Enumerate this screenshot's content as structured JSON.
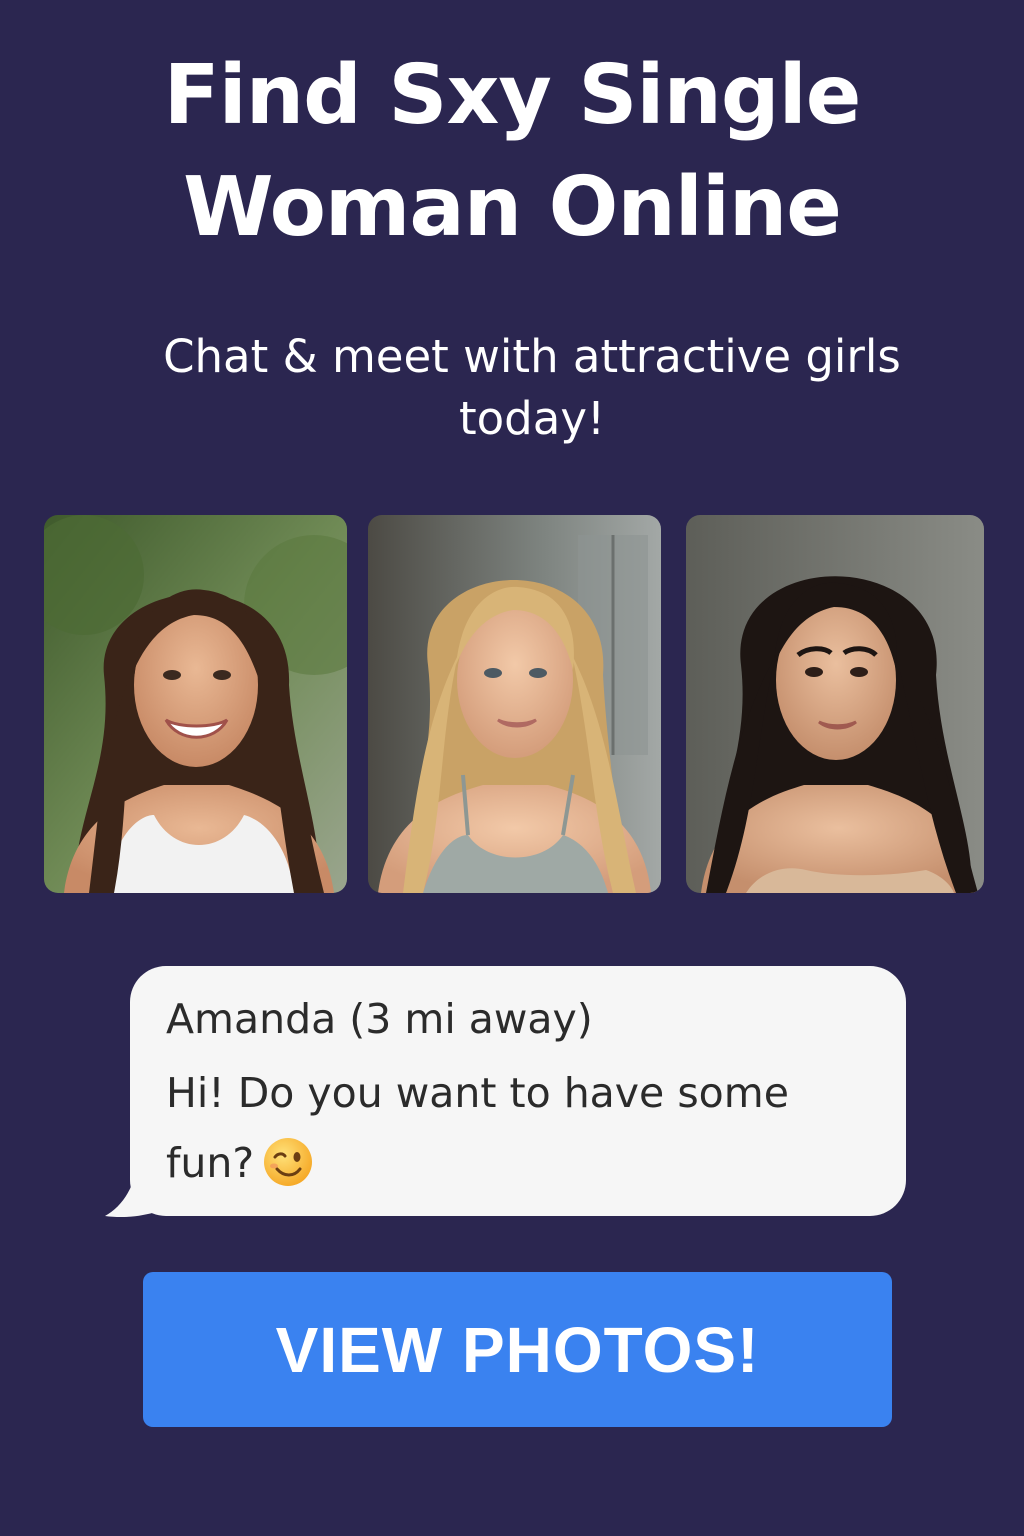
{
  "headline": {
    "line1": "Find Sxy Single",
    "line2": "Woman Online"
  },
  "subheadline": "Chat & meet with attractive girls today!",
  "profile_photos": [
    {
      "icon": "profile-photo-brunette-smiling"
    },
    {
      "icon": "profile-photo-blonde"
    },
    {
      "icon": "profile-photo-dark-hair"
    }
  ],
  "chat": {
    "sender": "Amanda (3 mi away)",
    "message": "Hi! Do you want to have some fun?",
    "emoji": "😉"
  },
  "cta": {
    "label": "VIEW PHOTOS!"
  },
  "colors": {
    "background": "#2b2650",
    "button": "#3a82f0",
    "bubble": "#f6f6f6"
  }
}
